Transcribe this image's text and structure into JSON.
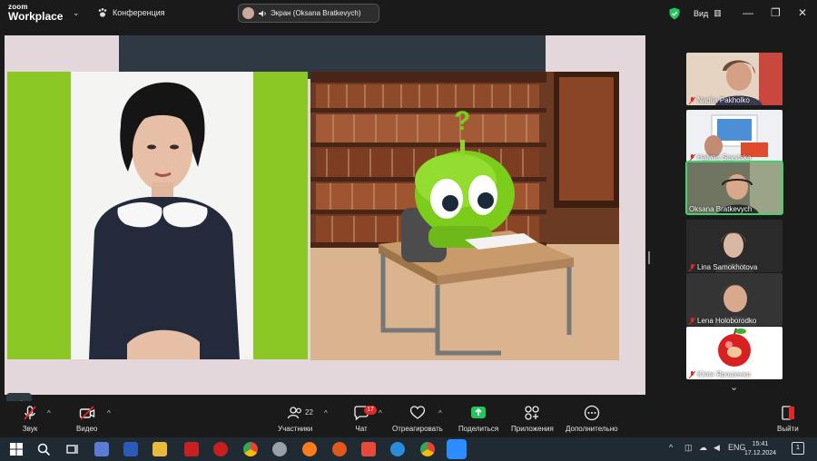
{
  "titlebar": {
    "brand_line1": "zoom",
    "brand_line2": "Workplace",
    "meeting_label": "Конференция",
    "share_label": "Экран (Oksana Bratkevych)",
    "view_label": "Вид",
    "icons": [
      "chevron-down-icon",
      "paw-icon",
      "speaker-icon",
      "shield-icon",
      "grid-icon",
      "minimize-icon",
      "restore-icon",
      "close-icon"
    ]
  },
  "participants": [
    {
      "name": "Nadiia Pakholko",
      "muted": true,
      "active": false
    },
    {
      "name": "Halyna Savytska",
      "muted": true,
      "active": false
    },
    {
      "name": "Oksana Bratkevych",
      "muted": false,
      "active": true
    },
    {
      "name": "Lina Samokhotova",
      "muted": true,
      "active": false
    },
    {
      "name": "Lena Holoborodko",
      "muted": true,
      "active": false
    },
    {
      "name": "Юлія Ярошенко",
      "muted": true,
      "active": false
    }
  ],
  "toolbar": {
    "audio": "Звук",
    "video": "Видео",
    "participants": "Участники",
    "participants_count": "22",
    "chat": "Чат",
    "chat_badge": "17",
    "react": "Отреагировать",
    "share": "Поделиться",
    "apps": "Приложения",
    "more": "Дополнительно",
    "leave": "Выйти"
  },
  "taskbar": {
    "lang": "ENG",
    "time": "15:41",
    "date": "17.12.2024",
    "notifications": "1"
  },
  "colors": {
    "accent_green": "#3fd36b",
    "share_green": "#22c55e",
    "leave_red": "#e02828",
    "slide_bg": "#e4d7dc",
    "slide_green": "#8bc725"
  }
}
